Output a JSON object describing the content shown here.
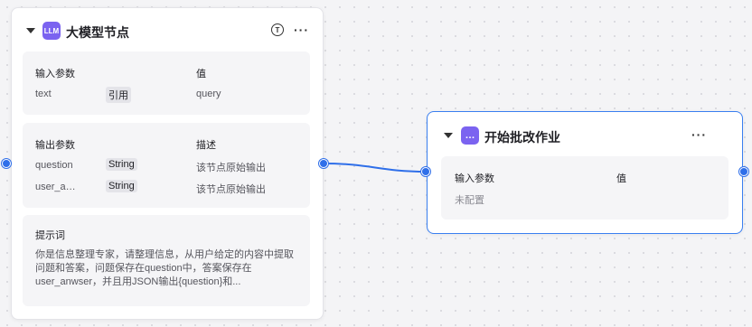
{
  "llm_node": {
    "icon": "LLM",
    "title": "大模型节点",
    "input_section": {
      "header_name": "输入参数",
      "header_value": "值",
      "rows": [
        {
          "name": "text",
          "type": "引用",
          "value": "query"
        }
      ]
    },
    "output_section": {
      "header_name": "输出参数",
      "header_desc": "描述",
      "rows": [
        {
          "name": "question",
          "type": "String",
          "desc": "该节点原始输出"
        },
        {
          "name": "user_a…",
          "type": "String",
          "desc": "该节点原始输出"
        }
      ]
    },
    "prompt_section": {
      "header": "提示词",
      "text": "你是信息整理专家，请整理信息，从用户给定的内容中提取问题和答案，问题保存在question中，答案保存在user_anwser，并且用JSON输出{question}和..."
    },
    "more_label": "···"
  },
  "start_node": {
    "title": "开始批改作业",
    "input_section": {
      "header_name": "输入参数",
      "header_value": "值",
      "empty_text": "未配置"
    },
    "more_label": "···"
  },
  "colors": {
    "edge": "#2f6fe9",
    "selected_border": "#3a7ff0",
    "llm_badge": "#7b63f0"
  }
}
